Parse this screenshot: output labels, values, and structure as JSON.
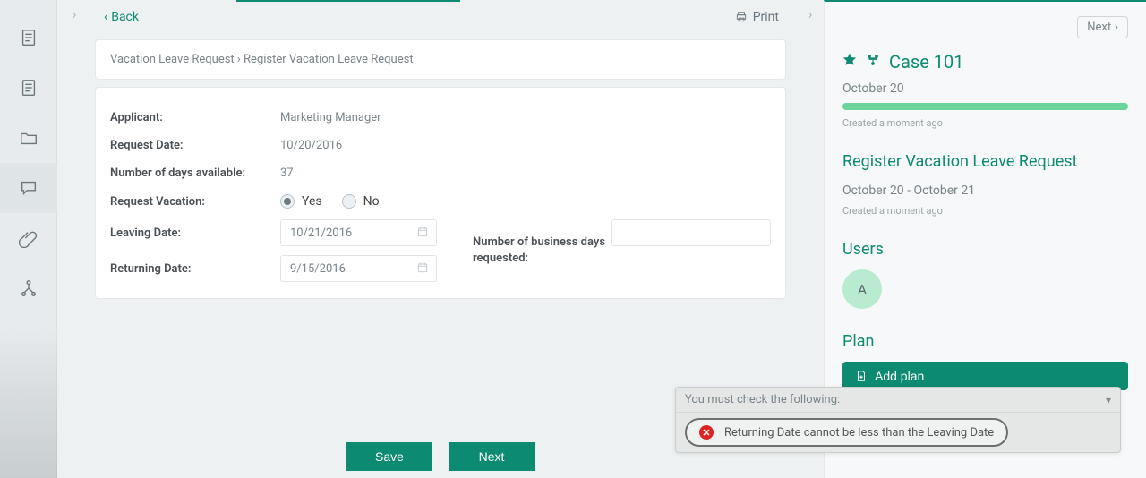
{
  "sidebar": {
    "items": [
      "file1",
      "file2",
      "folder",
      "comment",
      "attachment",
      "workflow"
    ]
  },
  "top": {
    "back_label": "Back",
    "print_label": "Print"
  },
  "breadcrumb": {
    "parent": "Vacation Leave Request",
    "sep": " › ",
    "current": "Register Vacation Leave Request"
  },
  "form": {
    "applicant_label": "Applicant:",
    "applicant_value": "Marketing Manager",
    "request_date_label": "Request Date:",
    "request_date_value": "10/20/2016",
    "days_available_label": "Number of days available:",
    "days_available_value": "37",
    "request_vacation_label": "Request Vacation:",
    "radio_yes": "Yes",
    "radio_no": "No",
    "radio_selected": "Yes",
    "leaving_label": "Leaving Date:",
    "leaving_value": "10/21/2016",
    "returning_label": "Returning Date:",
    "returning_value": "9/15/2016",
    "bizdays_label": "Number of business days requested:",
    "bizdays_value": ""
  },
  "actions": {
    "save": "Save",
    "next": "Next"
  },
  "right": {
    "next_nav": "Next",
    "case_title": "Case 101",
    "case_date": "October 20",
    "case_meta": "Created a moment ago",
    "step_title": "Register Vacation Leave Request",
    "step_daterange": "October 20 - October 21",
    "step_meta": "Created a moment ago",
    "users_title": "Users",
    "avatar_initial": "A",
    "plan_title": "Plan",
    "add_plan_label": "Add plan"
  },
  "toast": {
    "head": "You must check the following:",
    "message": "Returning Date cannot be less than the Leaving Date"
  },
  "colors": {
    "accent": "#0d8a72"
  }
}
